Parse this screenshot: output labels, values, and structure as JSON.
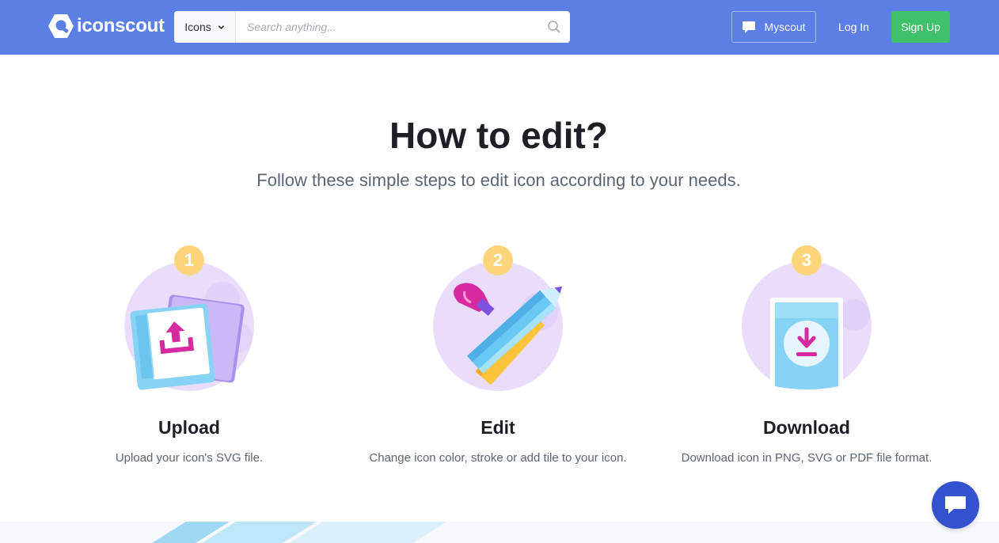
{
  "navbar": {
    "logo_text": "iconscout",
    "search": {
      "type_label": "Icons",
      "placeholder": "Search anything..."
    },
    "myscout_label": "Myscout",
    "login_label": "Log In",
    "signup_label": "Sign Up"
  },
  "main": {
    "title": "How to edit?",
    "subtitle": "Follow these simple steps to edit icon according to your needs.",
    "steps": [
      {
        "number": "1",
        "title": "Upload",
        "description": "Upload your icon's SVG file."
      },
      {
        "number": "2",
        "title": "Edit",
        "description": "Change icon color, stroke or add tile to your icon."
      },
      {
        "number": "3",
        "title": "Download",
        "description": "Download icon in PNG, SVG or PDF file format."
      }
    ]
  },
  "colors": {
    "navbar": "#5b7fe4",
    "signup": "#3fc16b",
    "step_badge": "#fcd47a",
    "circle": "#e9ddfb",
    "chat_fab": "#3451cf"
  }
}
